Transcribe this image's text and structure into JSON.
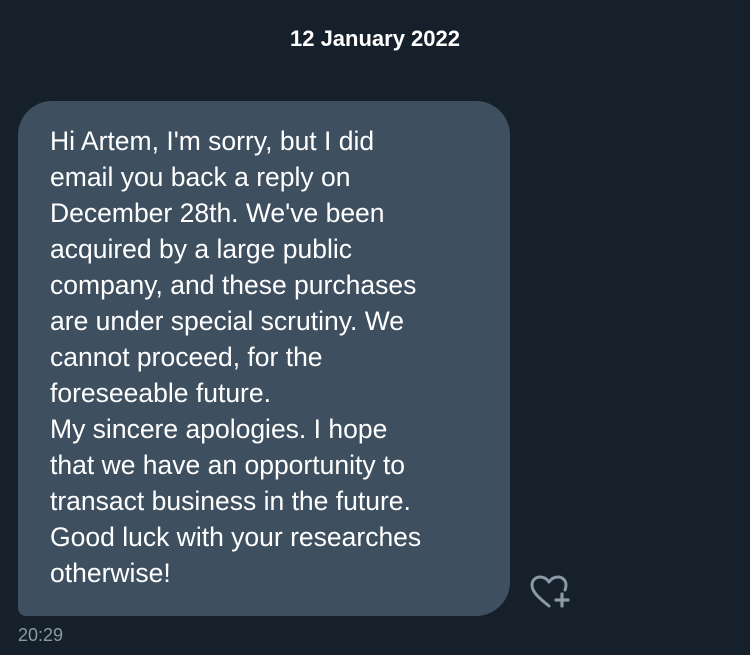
{
  "conversation": {
    "date_separator": "12 January 2022"
  },
  "message": {
    "lines": [
      "Hi Artem, I'm sorry, but I did",
      "email you back a reply on",
      "December 28th. We've been",
      "acquired by a large public",
      "company, and these purchases",
      "are under special scrutiny. We",
      "cannot proceed, for the",
      "foreseeable future.",
      "My sincere apologies. I hope",
      "that we have an opportunity to",
      "transact business in the future.",
      "Good luck with your researches",
      "otherwise!"
    ],
    "timestamp": "20:29",
    "reaction_icon": "heart-plus-icon"
  },
  "colors": {
    "background": "#15202b",
    "bubble": "#3e4f60",
    "text": "#ffffff",
    "muted": "#8b98a5"
  }
}
